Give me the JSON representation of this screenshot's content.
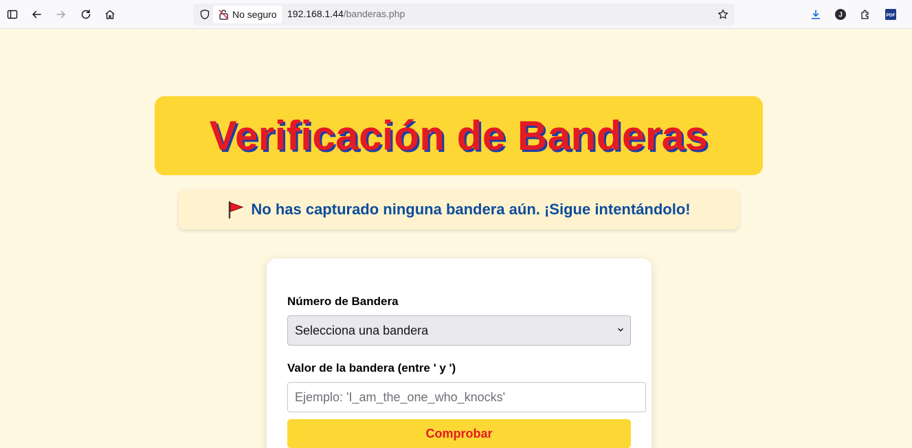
{
  "browser": {
    "security_label": "No seguro",
    "url_host": "192.168.1.44",
    "url_path": "/banderas.php",
    "profile_initial": "J",
    "pdf_label": "PDF",
    "icons": [
      "sidebar-icon",
      "back-icon",
      "forward-icon",
      "reload-icon",
      "home-icon",
      "shield-icon",
      "insecure-lock-icon",
      "star-icon",
      "download-icon",
      "profile-icon",
      "extensions-icon",
      "pdf-icon"
    ]
  },
  "page": {
    "title": "Verificación de Banderas",
    "status_message": "No has capturado ninguna bandera aún. ¡Sigue intentándolo!",
    "status_icon": "triangular-flag-icon"
  },
  "form": {
    "flag_number_label": "Número de Bandera",
    "flag_select_value": "Selecciona una bandera",
    "flag_value_label": "Valor de la bandera (entre ' y ')",
    "flag_value_placeholder": "Ejemplo: 'I_am_the_one_who_knocks'",
    "submit_label": "Comprobar"
  },
  "colors": {
    "page_background": "#fff8e1",
    "banner_yellow": "#fdd835",
    "title_red": "#e31b23",
    "title_shadow_blue": "#1a3fa8",
    "status_blue": "#0d4c9c"
  }
}
